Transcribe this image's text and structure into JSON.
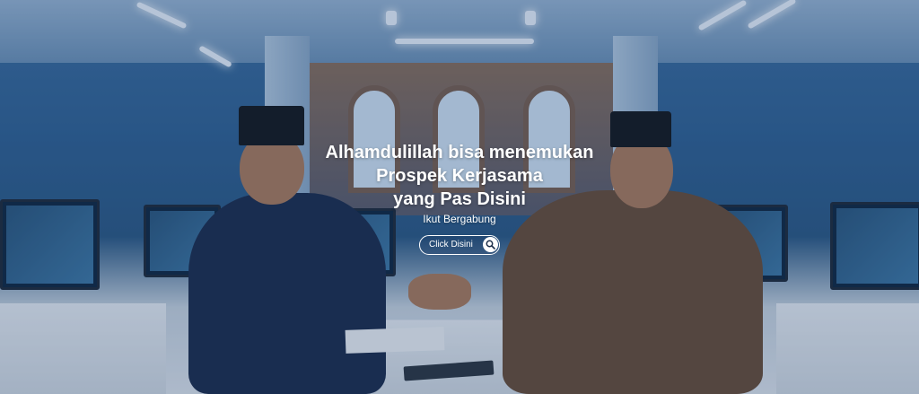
{
  "hero": {
    "headline_line1": "Alhamdulillah bisa menemukan",
    "headline_line2": "Prospek Kerjasama",
    "headline_line3": "yang Pas Disini",
    "subline": "Ikut Bergabung",
    "cta_label": "Click Disini",
    "cta_icon": "search-icon",
    "photo": "two-men-handshake-office"
  }
}
